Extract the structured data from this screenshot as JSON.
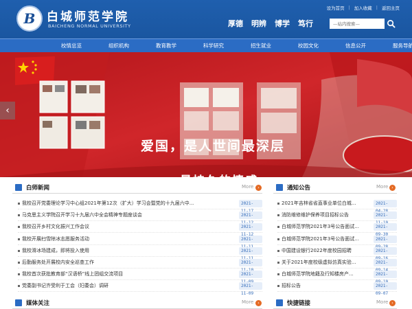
{
  "header": {
    "logo_mark": "B",
    "school_name_cn": "白城师范学院",
    "school_name_en": "BAICHENG NORMAL UNIVERSITY",
    "top_links": [
      "设为首页",
      "加入收藏",
      "返回主页"
    ],
    "motto": [
      "厚德",
      "明辨",
      "博学",
      "笃行"
    ],
    "search_placeholder": "—站内搜索—"
  },
  "nav": {
    "items": [
      "校情总览",
      "组织机构",
      "教育教学",
      "科学研究",
      "招生就业",
      "校园文化",
      "信息公开",
      "服务导航"
    ]
  },
  "banner": {
    "slogan_line1": "爱国，是人世间最深层",
    "slogan_line2": "最持久的情感",
    "prev_arrow": "‹"
  },
  "news": {
    "title": "白师新闻",
    "more": "More",
    "items": [
      {
        "title": "我校召开党委理论学习中心组2021年第12次（扩大）学习会暨党的十九届六中...",
        "date": "2021-11-17"
      },
      {
        "title": "马克思主义学院召开学习十九届六中全会精神专题座谈会",
        "date": "2021-11-12"
      },
      {
        "title": "我校召开乡村文化振兴工作会议",
        "date": "2021-11-12"
      },
      {
        "title": "我校开展扫雪除冰志愿服务活动",
        "date": "2021-11-11"
      },
      {
        "title": "我校滑冰场建成，即将投入使用",
        "date": "2021-11-11"
      },
      {
        "title": "后勤服务处开展校内安全巡查工作",
        "date": "2021-11-10"
      },
      {
        "title": "我校首次获批教育部“汉语桥”线上团组交流项目",
        "date": "2021-11-09"
      },
      {
        "title": "党委副书记齐受利于工会（妇委会）调研",
        "date": "2021-11-09"
      }
    ]
  },
  "notices": {
    "title": "通知公告",
    "more": "More",
    "items": [
      {
        "title": "2021年吉林省省直事业单位白城...",
        "date": "2021-04-28"
      },
      {
        "title": "消防维修维护保养项目招标公告",
        "date": "2021-11-10"
      },
      {
        "title": "白城师范学院2021年3号公告面试...",
        "date": "2021-09-30"
      },
      {
        "title": "白城师范学院2021年3号公告面试...",
        "date": "2021-09-28"
      },
      {
        "title": "中国建设银行2022年度校园招聘",
        "date": "2021-09-16"
      },
      {
        "title": "关于2021年度校级虚拟仿真实验...",
        "date": "2021-09-14"
      },
      {
        "title": "白城师范学院地籍及行知楼房产...",
        "date": "2021-09-10"
      },
      {
        "title": "招标公告",
        "date": "2021-09-07"
      }
    ]
  },
  "media": {
    "title": "媒体关注",
    "more": "More"
  },
  "links": {
    "title": "快捷链接",
    "more": "More"
  },
  "colors": {
    "brand_blue": "#1f5fae",
    "banner_red": "#c81a1e",
    "more_orange": "#e46a24"
  }
}
